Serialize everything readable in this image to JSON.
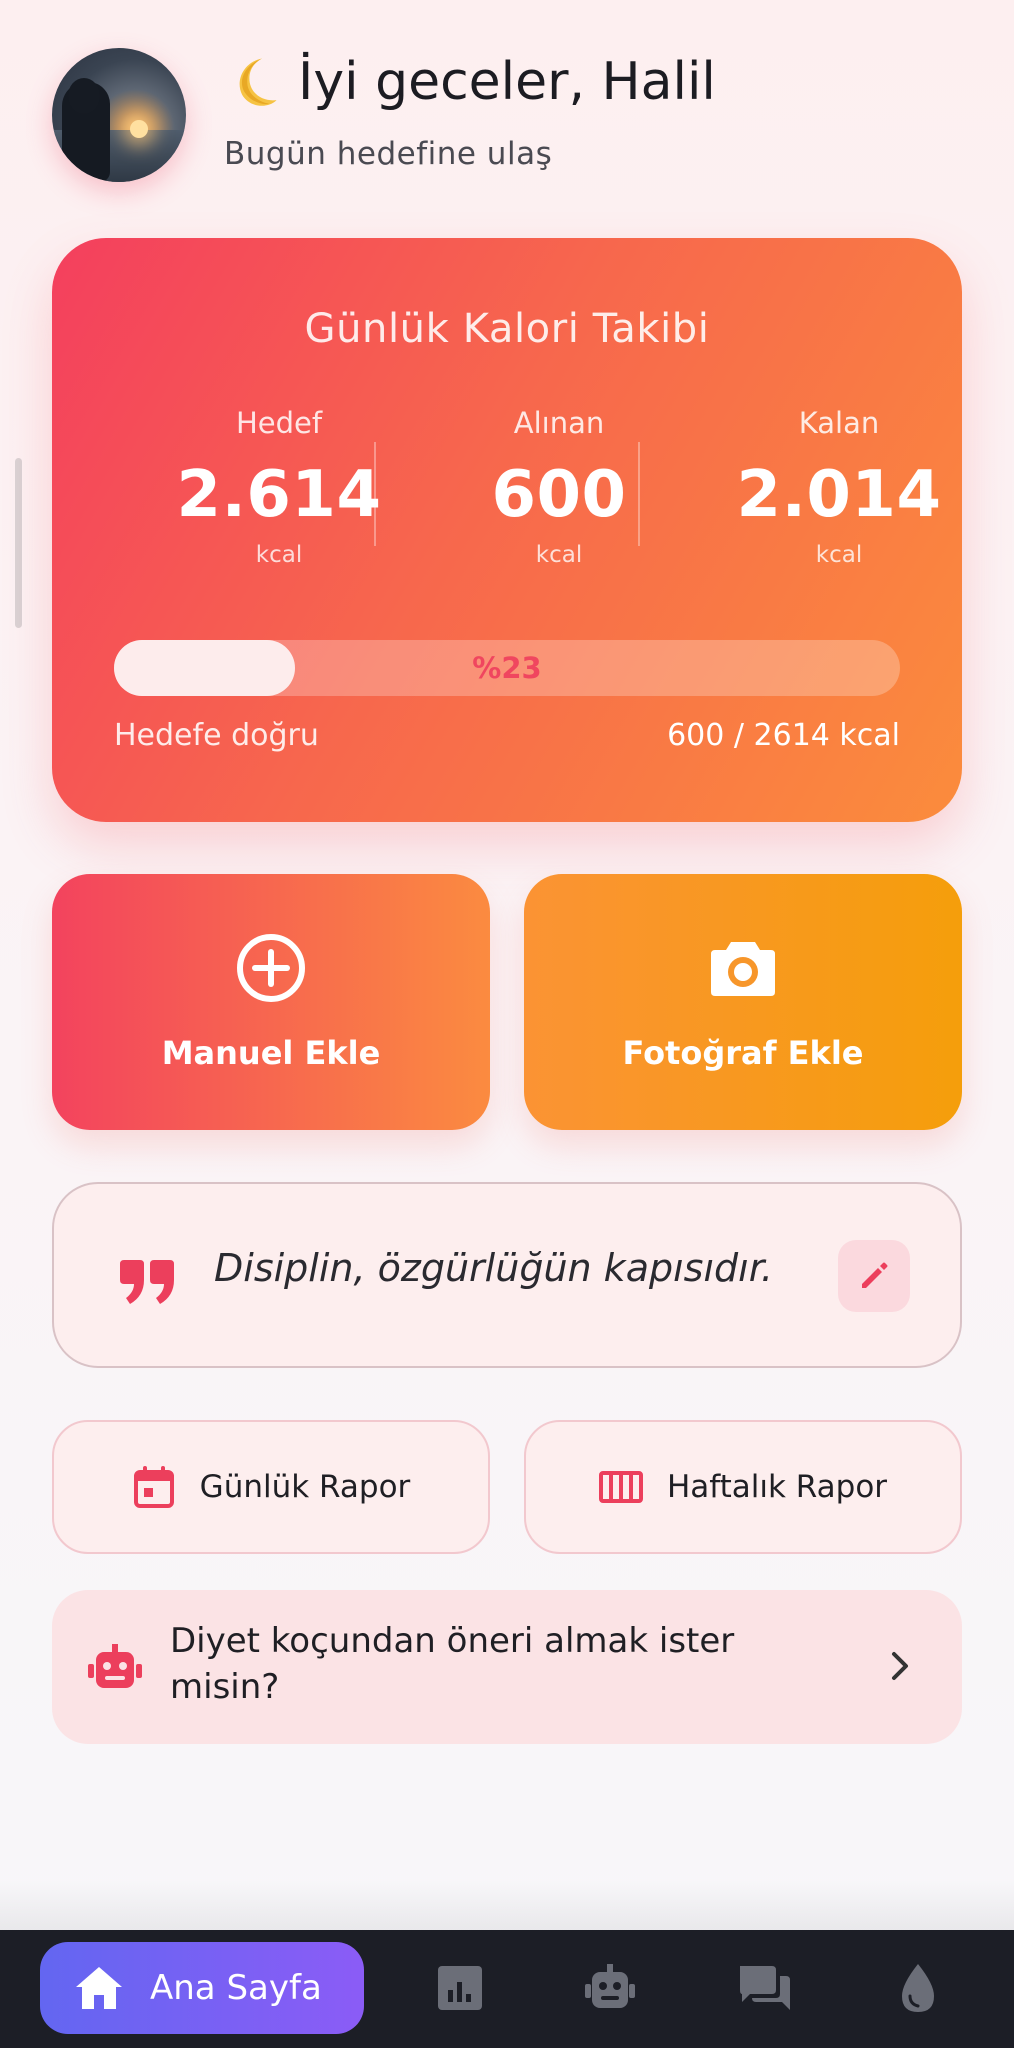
{
  "header": {
    "greeting": "İyi geceler, Halil",
    "greeting_icon": "crescent-moon-icon",
    "subtitle": "Bugün hedefine ulaş"
  },
  "calorie_card": {
    "title": "Günlük Kalori Takibi",
    "stats": [
      {
        "label": "Hedef",
        "value": "2.614",
        "unit": "kcal"
      },
      {
        "label": "Alınan",
        "value": "600",
        "unit": "kcal"
      },
      {
        "label": "Kalan",
        "value": "2.014",
        "unit": "kcal"
      }
    ],
    "progress_label": "%23",
    "progress_fraction": 0.23,
    "footer_left": "Hedefe doğru",
    "footer_right": "600 / 2614 kcal"
  },
  "actions": {
    "manual_label": "Manuel Ekle",
    "photo_label": "Fotoğraf Ekle"
  },
  "quote": {
    "text": "Disiplin, özgürlüğün kapısıdır."
  },
  "reports": {
    "daily_label": "Günlük Rapor",
    "weekly_label": "Haftalık Rapor"
  },
  "coach": {
    "text": "Diyet koçundan öneri almak ister misin?"
  },
  "bottom_nav": {
    "home_label": "Ana Sayfa",
    "items": [
      "home-icon",
      "stats-icon",
      "robot-icon",
      "chat-icon",
      "water-drop-icon"
    ]
  },
  "colors": {
    "accent_red": "#f43f5e",
    "accent_orange": "#fb8c3c",
    "amber": "#f59e0b",
    "nav_bg": "#1c1e26",
    "nav_active_start": "#6366f1",
    "nav_active_end": "#8b5cf6"
  }
}
